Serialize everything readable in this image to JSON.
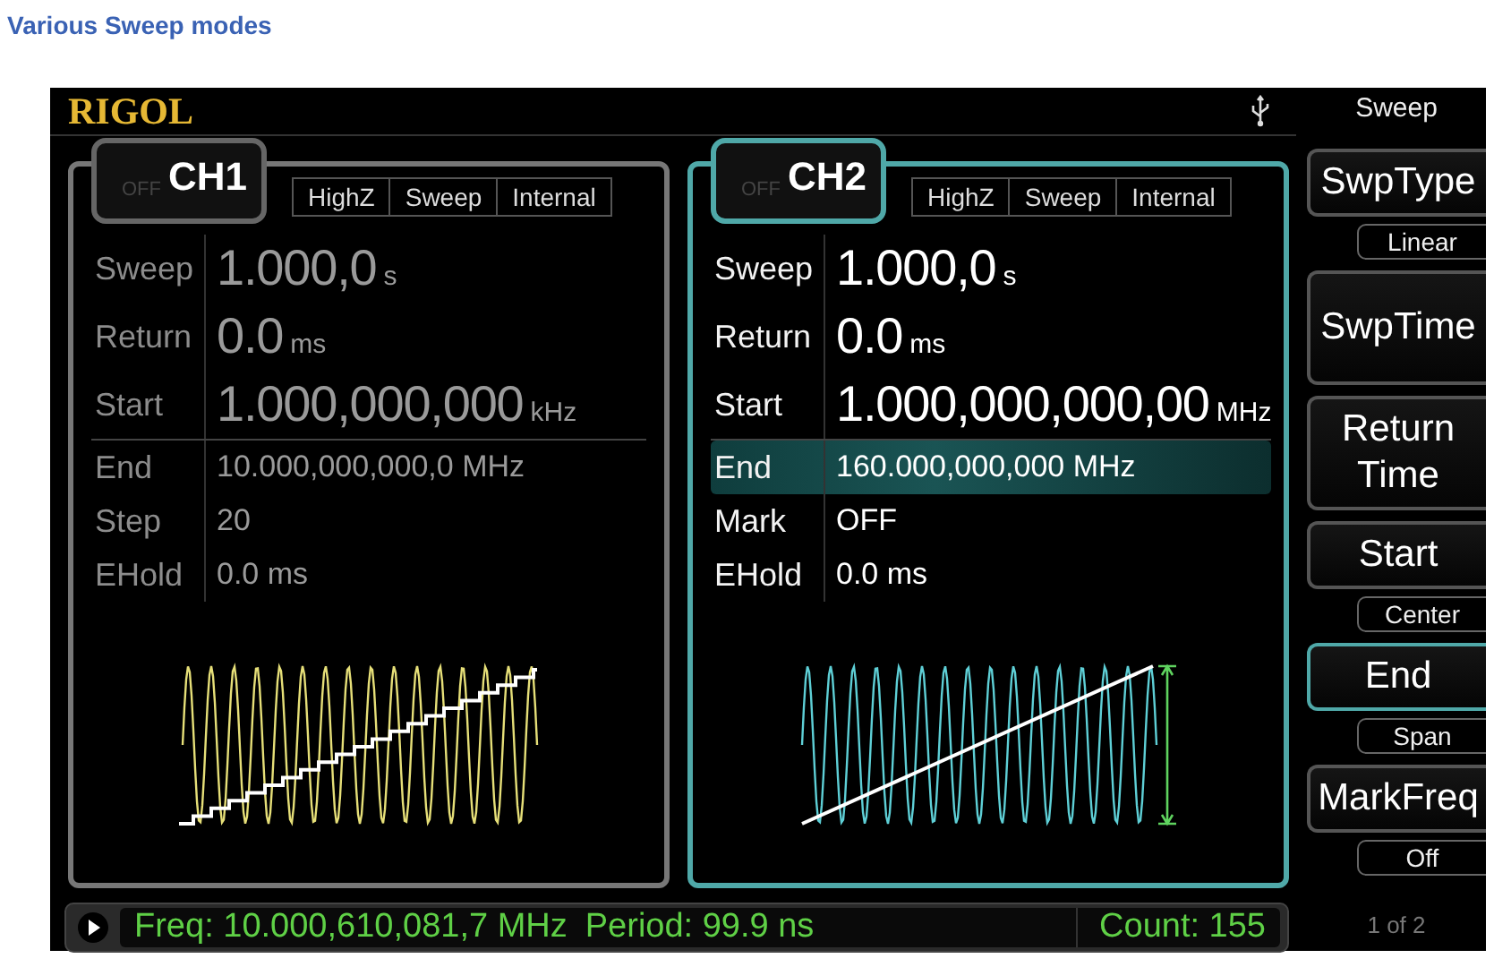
{
  "heading": "Various Sweep modes",
  "screen": {
    "logo": "RIGOL",
    "channels": [
      {
        "name": "CH1",
        "output": "OFF",
        "selected": false,
        "color": "#e6df78",
        "tags": [
          "HighZ",
          "Sweep",
          "Internal"
        ],
        "main_params": [
          {
            "label": "Sweep",
            "value": "1.000,0",
            "unit": "s"
          },
          {
            "label": "Return",
            "value": "0.0",
            "unit": "ms"
          },
          {
            "label": "Start",
            "value": "1.000,000,000",
            "unit": "kHz"
          }
        ],
        "params": [
          {
            "label": "End",
            "value": "10.000,000,000,0 MHz",
            "selected": false
          },
          {
            "label": "Step",
            "value": "20",
            "selected": false
          },
          {
            "label": "EHold",
            "value": "0.0 ms",
            "selected": false
          }
        ],
        "waveform": {
          "kind": "stepped"
        }
      },
      {
        "name": "CH2",
        "output": "OFF",
        "selected": true,
        "color": "#5ecfd6",
        "tags": [
          "HighZ",
          "Sweep",
          "Internal"
        ],
        "main_params": [
          {
            "label": "Sweep",
            "value": "1.000,0",
            "unit": "s"
          },
          {
            "label": "Return",
            "value": "0.0",
            "unit": "ms"
          },
          {
            "label": "Start",
            "value": "1.000,000,000,00",
            "unit": "MHz"
          }
        ],
        "params": [
          {
            "label": "End",
            "value": "160.000,000,000 MHz",
            "selected": true
          },
          {
            "label": "Mark",
            "value": "OFF",
            "selected": false
          },
          {
            "label": "EHold",
            "value": "0.0 ms",
            "selected": false
          }
        ],
        "waveform": {
          "kind": "linear"
        }
      }
    ],
    "menu": {
      "title": "Sweep",
      "keys": [
        {
          "label": "SwpType",
          "option": "Linear",
          "selected": false
        },
        {
          "label": "SwpTime",
          "selected": false
        },
        {
          "label": "Return Time",
          "selected": false
        },
        {
          "label": "Start",
          "option": "Center",
          "selected": false
        },
        {
          "label": "End",
          "option": "Span",
          "selected": true
        },
        {
          "label": "MarkFreq",
          "option": "Off",
          "selected": false
        }
      ],
      "page": "1 of 2"
    },
    "status": {
      "freq": "Freq: 10.000,610,081,7 MHz",
      "period": "Period: 99.9 ns",
      "count": "Count: 155"
    }
  }
}
